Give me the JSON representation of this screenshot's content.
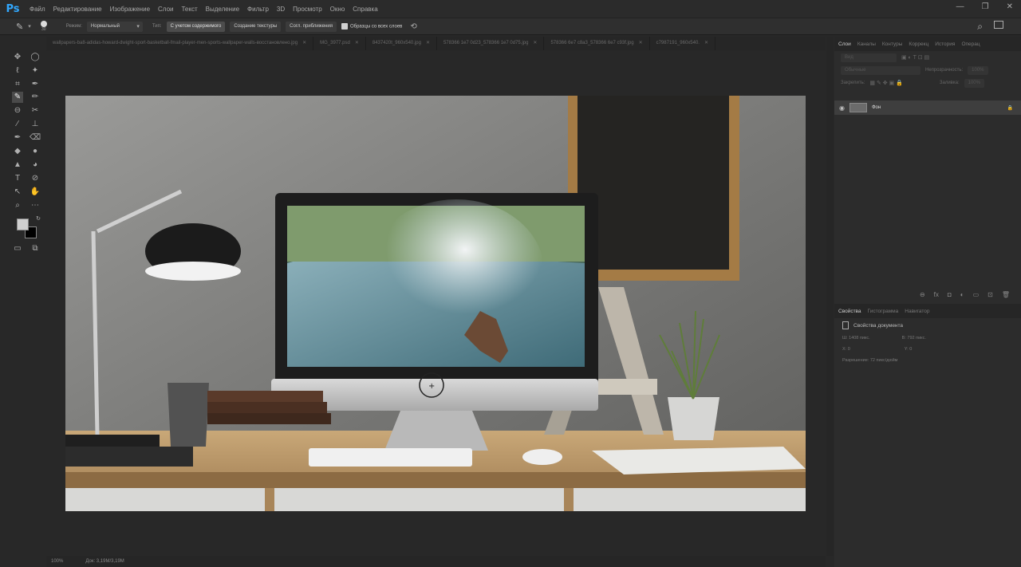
{
  "app": {
    "logo": "Ps"
  },
  "menu": [
    "Файл",
    "Редактирование",
    "Изображение",
    "Слои",
    "Текст",
    "Выделение",
    "Фильтр",
    "3D",
    "Просмотр",
    "Окно",
    "Справка"
  ],
  "window_controls": [
    "—",
    "❐",
    "✕"
  ],
  "options": {
    "brush_size": "30",
    "mode_label": "Режим:",
    "mode_value": "Нормальный",
    "type_label": "Тип:",
    "type_buttons": [
      "С учетом содержимого",
      "Создание текстуры",
      "Согл. приближения"
    ],
    "sample_all_label": "Образцы со всех слоев"
  },
  "doc_tabs": [
    "wallpapers-ba8-adidas-howard-dwight-sport-basketball-fmail-player-men-sports-wallpaper-walls-восстановлено.jpg",
    "MG_3977.psd",
    "8437420t_960x540.jpg",
    "578366 1e7 0d23_578366 1e7 0d75.jpg",
    "578366 6e7 c8a3_578366 6e7 c93f.jpg",
    "c7987191_960x540."
  ],
  "status": {
    "zoom": "100%",
    "doc": "Док: 3,19M/3,19M"
  },
  "layers_panel": {
    "tabs": [
      "Слои",
      "Каналы",
      "Контуры",
      "Коррекц",
      "История",
      "Операц"
    ],
    "kind_label": "Вид",
    "blend": "Обычные",
    "opacity_label": "Непрозрачность:",
    "opacity_value": "100%",
    "lock_label": "Закрепить:",
    "fill_label": "Заливка:",
    "fill_value": "100%",
    "layer_name": "Фон"
  },
  "props_panel": {
    "tabs": [
      "Свойства",
      "Гистограмма",
      "Навигатор"
    ],
    "title": "Свойства документа",
    "w_label": "Ш:",
    "w_value": "1408 пикс.",
    "h_label": "В:",
    "h_value": "792 пикс.",
    "x_label": "X:",
    "x_value": "0",
    "y_label": "Y:",
    "y_value": "0",
    "resolution": "Разрешение: 72 пикс/дюйм"
  }
}
